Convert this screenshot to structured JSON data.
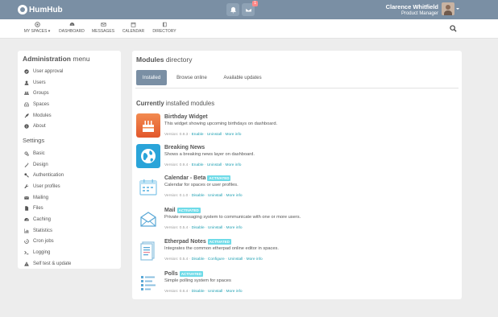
{
  "app": {
    "brand": "HumHub"
  },
  "topbar": {
    "messages_badge": "1",
    "user_name": "Clarence Whitfield",
    "user_title": "Product Manager"
  },
  "nav": {
    "items": [
      {
        "label": "My Spaces",
        "icon": "dot-circle-icon"
      },
      {
        "label": "Dashboard",
        "icon": "tachometer-icon"
      },
      {
        "label": "Messages",
        "icon": "envelope-icon"
      },
      {
        "label": "Calendar",
        "icon": "calendar-icon"
      },
      {
        "label": "Directory",
        "icon": "book-icon"
      }
    ]
  },
  "admin_menu": {
    "title_bold": "Administration",
    "title_rest": "menu",
    "items": [
      {
        "label": "User approval",
        "icon": "check-circle-icon"
      },
      {
        "label": "Users",
        "icon": "user-icon"
      },
      {
        "label": "Groups",
        "icon": "group-icon"
      },
      {
        "label": "Spaces",
        "icon": "inbox-icon"
      },
      {
        "label": "Modules",
        "icon": "rocket-icon"
      },
      {
        "label": "About",
        "icon": "info-circle-icon"
      }
    ],
    "settings_title": "Settings",
    "settings_items": [
      {
        "label": "Basic",
        "icon": "cogs-icon"
      },
      {
        "label": "Design",
        "icon": "magic-icon"
      },
      {
        "label": "Authentication",
        "icon": "key-icon"
      },
      {
        "label": "User profiles",
        "icon": "wrench-icon"
      },
      {
        "label": "Mailing",
        "icon": "envelope-icon"
      },
      {
        "label": "Files",
        "icon": "file-icon"
      },
      {
        "label": "Caching",
        "icon": "dashboard-icon"
      },
      {
        "label": "Statistics",
        "icon": "bar-chart-icon"
      },
      {
        "label": "Cron jobs",
        "icon": "history-icon"
      },
      {
        "label": "Logging",
        "icon": "terminal-icon"
      },
      {
        "label": "Self test & update",
        "icon": "warning-icon"
      }
    ]
  },
  "modules_directory": {
    "title_bold": "Modules",
    "title_rest": "directory",
    "tabs": [
      {
        "label": "Installed",
        "active": true
      },
      {
        "label": "Browse online",
        "active": false
      },
      {
        "label": "Available updates",
        "active": false
      }
    ],
    "section_bold": "Currently",
    "section_rest": "installed modules",
    "activated_label": "ACTIVATED",
    "modules": [
      {
        "name": "Birthday Widget",
        "activated": false,
        "description": "This widget showing upcoming birthdays on dashboard.",
        "version": "Version: 0.9.3",
        "actions": [
          "Enable",
          "Uninstall",
          "More info"
        ],
        "icon": "birthday-cake-icon"
      },
      {
        "name": "Breaking News",
        "activated": false,
        "description": "Shows a breaking news layer on dashboard.",
        "version": "Version: 0.9.4",
        "actions": [
          "Enable",
          "Uninstall",
          "More info"
        ],
        "icon": "globe-icon"
      },
      {
        "name": "Calendar - Beta",
        "activated": true,
        "description": "Calendar for spaces or user profiles.",
        "version": "Version: 0.1.0",
        "actions": [
          "Disable",
          "Uninstall",
          "More info"
        ],
        "icon": "calendar-module-icon"
      },
      {
        "name": "Mail",
        "activated": true,
        "description": "Private messaging system to communicate with one or more users.",
        "version": "Version: 0.5.4",
        "actions": [
          "Disable",
          "Uninstall",
          "More info"
        ],
        "icon": "mail-module-icon"
      },
      {
        "name": "Etherpad Notes",
        "activated": true,
        "description": "Integrates the common etherpad online editor in spaces.",
        "version": "Version: 0.5.4",
        "actions": [
          "Disable",
          "Configure",
          "Uninstall",
          "More info"
        ],
        "icon": "notes-module-icon"
      },
      {
        "name": "Polls",
        "activated": true,
        "description": "Simple polling system for spaces",
        "version": "Version: 0.6.4",
        "actions": [
          "Disable",
          "Uninstall",
          "More info"
        ],
        "icon": "polls-module-icon"
      }
    ]
  },
  "colors": {
    "topbar": "#7a8fa4",
    "accent": "#21a1b3",
    "activated_badge": "#6fdbe8",
    "background": "#ededed"
  }
}
